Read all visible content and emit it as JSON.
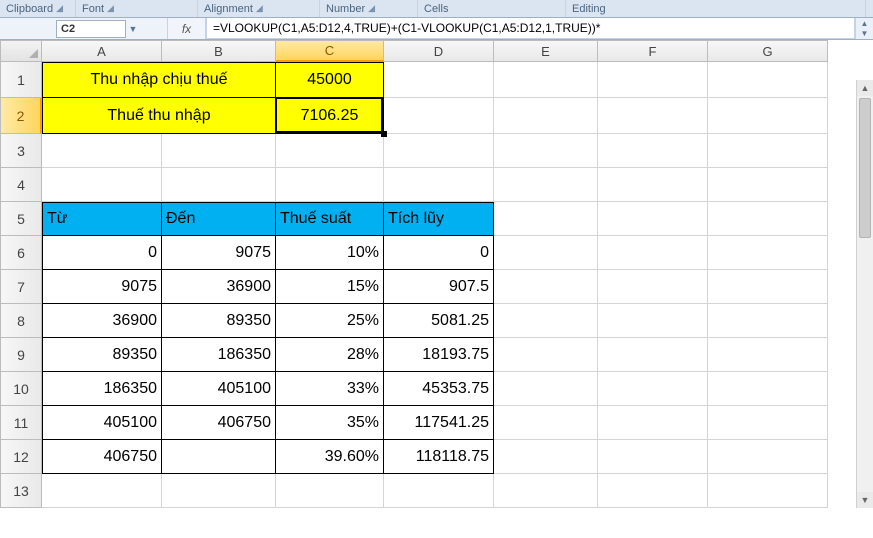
{
  "ribbon": {
    "groups": [
      "Clipboard",
      "Font",
      "Alignment",
      "Number",
      "Cells",
      "Editing"
    ]
  },
  "formula_bar": {
    "cell_ref": "C2",
    "fx_label": "fx",
    "formula": "=VLOOKUP(C1,A5:D12,4,TRUE)+(C1-VLOOKUP(C1,A5:D12,1,TRUE))*"
  },
  "columns": [
    "A",
    "B",
    "C",
    "D",
    "E",
    "F",
    "G"
  ],
  "col_classes": [
    "colA",
    "colB",
    "colC",
    "colD",
    "colE",
    "colF",
    "colG"
  ],
  "active_col_index": 2,
  "active_row_index": 1,
  "rows": [
    {
      "num": "1",
      "h": "row-h1",
      "cells": [
        {
          "v": "Thu nhập chịu thuế",
          "align": "center",
          "cls": "yellow-fill blackborder-t blackborder-l blackborder-b blackborder-r",
          "span": 2
        },
        {
          "v": "45000",
          "align": "center",
          "cls": "yellow-fill blackborder-t blackborder-b blackborder-r"
        },
        {
          "v": ""
        },
        {
          "v": ""
        },
        {
          "v": ""
        },
        {
          "v": ""
        }
      ]
    },
    {
      "num": "2",
      "h": "row-h1",
      "cells": [
        {
          "v": "Thuế thu nhập",
          "align": "center",
          "cls": "yellow-fill blackborder-l blackborder-b blackborder-r",
          "span": 2
        },
        {
          "v": "7106.25",
          "align": "center",
          "cls": "yellow-fill blackborder-b blackborder-r",
          "active": true
        },
        {
          "v": ""
        },
        {
          "v": ""
        },
        {
          "v": ""
        },
        {
          "v": ""
        }
      ]
    },
    {
      "num": "3",
      "h": "row-hd",
      "cells": [
        {
          "v": ""
        },
        {
          "v": ""
        },
        {
          "v": ""
        },
        {
          "v": ""
        },
        {
          "v": ""
        },
        {
          "v": ""
        },
        {
          "v": ""
        }
      ]
    },
    {
      "num": "4",
      "h": "row-hd",
      "cells": [
        {
          "v": ""
        },
        {
          "v": ""
        },
        {
          "v": ""
        },
        {
          "v": ""
        },
        {
          "v": ""
        },
        {
          "v": ""
        },
        {
          "v": ""
        }
      ]
    },
    {
      "num": "5",
      "h": "row-hd",
      "cells": [
        {
          "v": "Từ",
          "cls": "cyan-fill blackborder-t blackborder-l blackborder-b blackborder-r"
        },
        {
          "v": "Đến",
          "cls": "cyan-fill blackborder-t blackborder-b blackborder-r"
        },
        {
          "v": "Thuế suất",
          "cls": "cyan-fill blackborder-t blackborder-b blackborder-r"
        },
        {
          "v": "Tích lũy",
          "cls": "cyan-fill blackborder-t blackborder-b blackborder-r"
        },
        {
          "v": ""
        },
        {
          "v": ""
        },
        {
          "v": ""
        }
      ]
    },
    {
      "num": "6",
      "h": "row-hd",
      "cells": [
        {
          "v": "0",
          "align": "right",
          "cls": "blackborder-l blackborder-b blackborder-r"
        },
        {
          "v": "9075",
          "align": "right",
          "cls": "blackborder-b blackborder-r"
        },
        {
          "v": "10%",
          "align": "right",
          "cls": "blackborder-b blackborder-r"
        },
        {
          "v": "0",
          "align": "right",
          "cls": "blackborder-b blackborder-r"
        },
        {
          "v": ""
        },
        {
          "v": ""
        },
        {
          "v": ""
        }
      ]
    },
    {
      "num": "7",
      "h": "row-hd",
      "cells": [
        {
          "v": "9075",
          "align": "right",
          "cls": "blackborder-l blackborder-b blackborder-r"
        },
        {
          "v": "36900",
          "align": "right",
          "cls": "blackborder-b blackborder-r"
        },
        {
          "v": "15%",
          "align": "right",
          "cls": "blackborder-b blackborder-r"
        },
        {
          "v": "907.5",
          "align": "right",
          "cls": "blackborder-b blackborder-r"
        },
        {
          "v": ""
        },
        {
          "v": ""
        },
        {
          "v": ""
        }
      ]
    },
    {
      "num": "8",
      "h": "row-hd",
      "cells": [
        {
          "v": "36900",
          "align": "right",
          "cls": "blackborder-l blackborder-b blackborder-r"
        },
        {
          "v": "89350",
          "align": "right",
          "cls": "blackborder-b blackborder-r"
        },
        {
          "v": "25%",
          "align": "right",
          "cls": "blackborder-b blackborder-r"
        },
        {
          "v": "5081.25",
          "align": "right",
          "cls": "blackborder-b blackborder-r"
        },
        {
          "v": ""
        },
        {
          "v": ""
        },
        {
          "v": ""
        }
      ]
    },
    {
      "num": "9",
      "h": "row-hd",
      "cells": [
        {
          "v": "89350",
          "align": "right",
          "cls": "blackborder-l blackborder-b blackborder-r"
        },
        {
          "v": "186350",
          "align": "right",
          "cls": "blackborder-b blackborder-r"
        },
        {
          "v": "28%",
          "align": "right",
          "cls": "blackborder-b blackborder-r"
        },
        {
          "v": "18193.75",
          "align": "right",
          "cls": "blackborder-b blackborder-r"
        },
        {
          "v": ""
        },
        {
          "v": ""
        },
        {
          "v": ""
        }
      ]
    },
    {
      "num": "10",
      "h": "row-hd",
      "cells": [
        {
          "v": "186350",
          "align": "right",
          "cls": "blackborder-l blackborder-b blackborder-r"
        },
        {
          "v": "405100",
          "align": "right",
          "cls": "blackborder-b blackborder-r"
        },
        {
          "v": "33%",
          "align": "right",
          "cls": "blackborder-b blackborder-r"
        },
        {
          "v": "45353.75",
          "align": "right",
          "cls": "blackborder-b blackborder-r"
        },
        {
          "v": ""
        },
        {
          "v": ""
        },
        {
          "v": ""
        }
      ]
    },
    {
      "num": "11",
      "h": "row-hd",
      "cells": [
        {
          "v": "405100",
          "align": "right",
          "cls": "blackborder-l blackborder-b blackborder-r"
        },
        {
          "v": "406750",
          "align": "right",
          "cls": "blackborder-b blackborder-r"
        },
        {
          "v": "35%",
          "align": "right",
          "cls": "blackborder-b blackborder-r"
        },
        {
          "v": "117541.25",
          "align": "right",
          "cls": "blackborder-b blackborder-r"
        },
        {
          "v": ""
        },
        {
          "v": ""
        },
        {
          "v": ""
        }
      ]
    },
    {
      "num": "12",
      "h": "row-hd",
      "cells": [
        {
          "v": "406750",
          "align": "right",
          "cls": "blackborder-l blackborder-b blackborder-r"
        },
        {
          "v": "",
          "cls": "blackborder-b blackborder-r"
        },
        {
          "v": "39.60%",
          "align": "right",
          "cls": "blackborder-b blackborder-r"
        },
        {
          "v": "118118.75",
          "align": "right",
          "cls": "blackborder-b blackborder-r"
        },
        {
          "v": ""
        },
        {
          "v": ""
        },
        {
          "v": ""
        }
      ]
    },
    {
      "num": "13",
      "h": "row-hd",
      "cells": [
        {
          "v": ""
        },
        {
          "v": ""
        },
        {
          "v": ""
        },
        {
          "v": ""
        },
        {
          "v": ""
        },
        {
          "v": ""
        },
        {
          "v": ""
        }
      ]
    }
  ],
  "chart_data": {
    "type": "table",
    "title": "Tax brackets lookup table",
    "inputs": {
      "Thu nhập chịu thuế": 45000,
      "Thuế thu nhập": 7106.25
    },
    "columns": [
      "Từ",
      "Đến",
      "Thuế suất",
      "Tích lũy"
    ],
    "rows": [
      [
        0,
        9075,
        0.1,
        0
      ],
      [
        9075,
        36900,
        0.15,
        907.5
      ],
      [
        36900,
        89350,
        0.25,
        5081.25
      ],
      [
        89350,
        186350,
        0.28,
        18193.75
      ],
      [
        186350,
        405100,
        0.33,
        45353.75
      ],
      [
        405100,
        406750,
        0.35,
        117541.25
      ],
      [
        406750,
        null,
        0.396,
        118118.75
      ]
    ]
  }
}
